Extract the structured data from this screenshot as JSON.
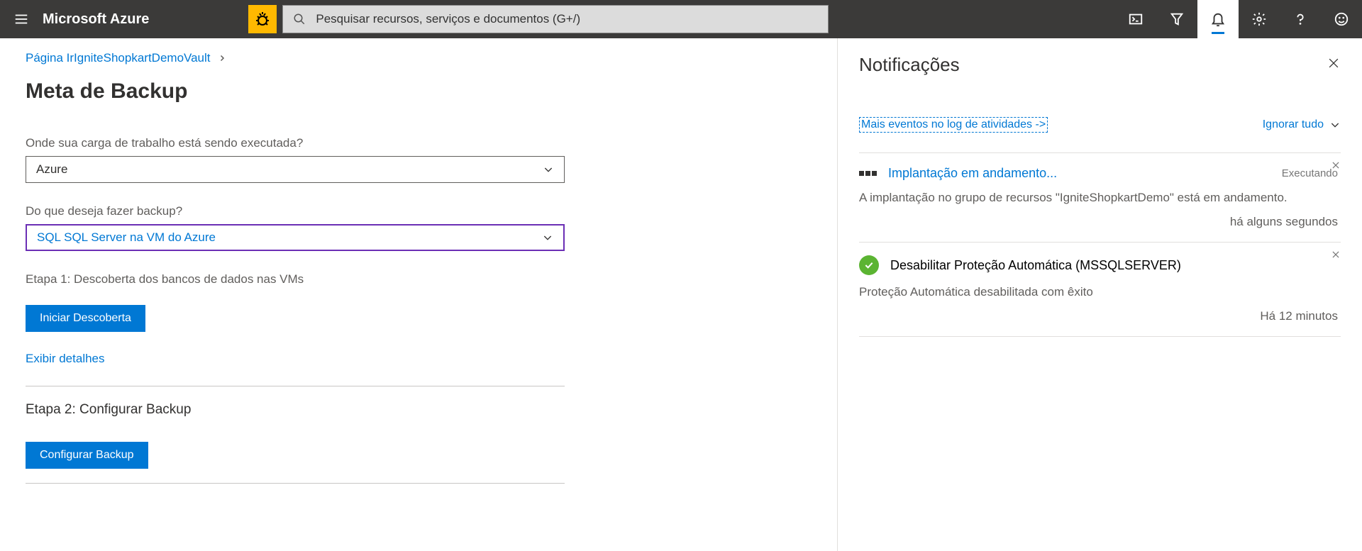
{
  "header": {
    "brand": "Microsoft Azure",
    "search_placeholder": "Pesquisar recursos, serviços e documentos (G+/)"
  },
  "breadcrumb": {
    "item1": "Página IrIgniteShopkartDemoVault"
  },
  "page": {
    "title": "Meta de Backup",
    "workload_label": "Onde sua carga de trabalho está sendo executada?",
    "workload_value": "Azure",
    "backup_label": "Do que deseja fazer backup?",
    "backup_value": "SQL SQL Server na VM do Azure",
    "step1_label": "Etapa 1: Descoberta dos bancos de dados nas VMs",
    "step1_button": "Iniciar Descoberta",
    "details_link": "Exibir detalhes",
    "step2_label": "Etapa 2: Configurar Backup",
    "step2_button": "Configurar Backup"
  },
  "notifications": {
    "title": "Notificações",
    "activity_link": "Mais eventos no log de atividades ->",
    "dismiss_all": "Ignorar tudo",
    "items": [
      {
        "title": "Implantação em andamento...",
        "status": "Executando",
        "description": "A implantação no grupo de recursos \"IgniteShopkartDemo\" está em andamento.",
        "time": "há alguns segundos"
      },
      {
        "title": "Desabilitar Proteção Automática (MSSQLSERVER)",
        "description": "Proteção Automática desabilitada com êxito",
        "time": "Há 12 minutos"
      }
    ]
  }
}
